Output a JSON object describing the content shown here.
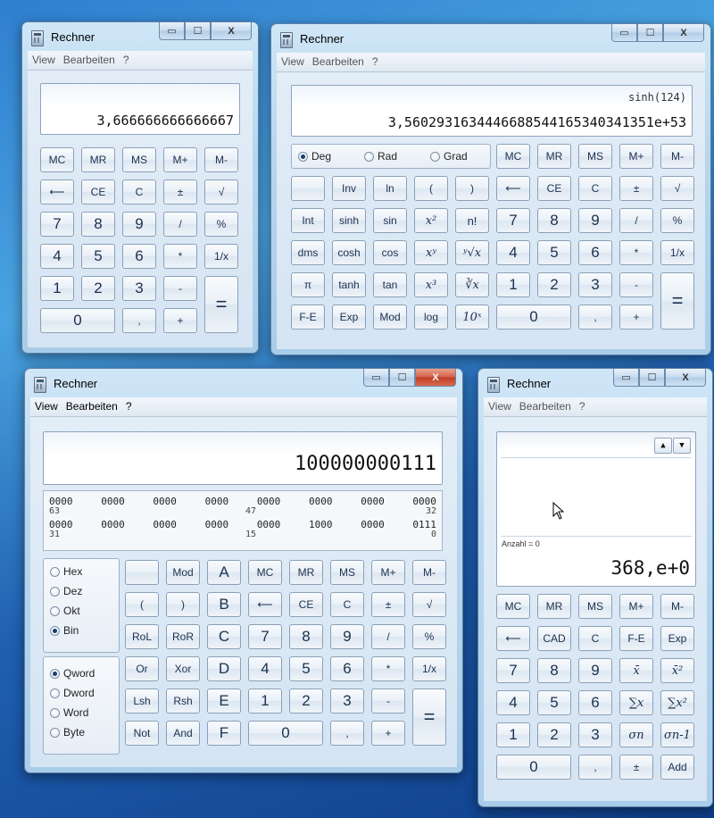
{
  "title": "Rechner",
  "menu": [
    "View",
    "Bearbeiten",
    "?"
  ],
  "window_controls": {
    "minimize": "▭",
    "maximize": "☐",
    "close": "X"
  },
  "std": {
    "display": "3,666666666666667",
    "rows": [
      [
        "MC",
        "MR",
        "MS",
        "M+",
        "M-"
      ],
      [
        "⟵",
        "CE",
        "C",
        "±",
        "√"
      ],
      [
        "7",
        "8",
        "9",
        "/",
        "%"
      ],
      [
        "4",
        "5",
        "6",
        "*",
        "1/x"
      ],
      [
        "1",
        "2",
        "3",
        "-"
      ],
      [
        "0",
        ",",
        "+"
      ]
    ],
    "equals": "="
  },
  "sci": {
    "expression": "sinh(124)",
    "display": "3,5602931634446688544165340341351e+53",
    "angle_modes": [
      "Deg",
      "Rad",
      "Grad"
    ],
    "selected_angle": "Deg",
    "fn_rows": [
      [
        "",
        "Inv",
        "ln",
        "(",
        ")"
      ],
      [
        "Int",
        "sinh",
        "sin",
        "x²",
        "n!"
      ],
      [
        "dms",
        "cosh",
        "cos",
        "xʸ",
        "ʸ√x"
      ],
      [
        "π",
        "tanh",
        "tan",
        "x³",
        "∛x"
      ],
      [
        "F-E",
        "Exp",
        "Mod",
        "log",
        "10ˣ"
      ]
    ],
    "num_rows": [
      [
        "MC",
        "MR",
        "MS",
        "M+",
        "M-"
      ],
      [
        "⟵",
        "CE",
        "C",
        "±",
        "√"
      ],
      [
        "7",
        "8",
        "9",
        "/",
        "%"
      ],
      [
        "4",
        "5",
        "6",
        "*",
        "1/x"
      ],
      [
        "1",
        "2",
        "3",
        "-"
      ],
      [
        "0",
        ",",
        "+"
      ]
    ],
    "equals": "="
  },
  "prog": {
    "display": "100000000111",
    "bits_row1": [
      "0000",
      "0000",
      "0000",
      "0000",
      "0000",
      "0000",
      "0000",
      "0000"
    ],
    "bits_row1_idx": [
      "63",
      "47",
      "32"
    ],
    "bits_row2": [
      "0000",
      "0000",
      "0000",
      "0000",
      "0000",
      "1000",
      "0000",
      "0111"
    ],
    "bits_row2_idx": [
      "31",
      "15",
      "0"
    ],
    "base_modes": [
      "Hex",
      "Dez",
      "Okt",
      "Bin"
    ],
    "selected_base": "Bin",
    "word_modes": [
      "Qword",
      "Dword",
      "Word",
      "Byte"
    ],
    "selected_word": "Qword",
    "rows": [
      [
        "",
        "Mod",
        "A",
        "MC",
        "MR",
        "MS",
        "M+",
        "M-"
      ],
      [
        "(",
        ")",
        "B",
        "⟵",
        "CE",
        "C",
        "±",
        "√"
      ],
      [
        "RoL",
        "RoR",
        "C",
        "7",
        "8",
        "9",
        "/",
        "%"
      ],
      [
        "Or",
        "Xor",
        "D",
        "4",
        "5",
        "6",
        "*",
        "1/x"
      ],
      [
        "Lsh",
        "Rsh",
        "E",
        "1",
        "2",
        "3",
        "-"
      ],
      [
        "Not",
        "And",
        "F",
        "0",
        ",",
        "+"
      ]
    ],
    "equals": "="
  },
  "stat": {
    "count_label": "Anzahl = 0",
    "display": "368,e+0",
    "rows": [
      [
        "MC",
        "MR",
        "MS",
        "M+",
        "M-"
      ],
      [
        "⟵",
        "CAD",
        "C",
        "F-E",
        "Exp"
      ],
      [
        "7",
        "8",
        "9",
        "x̄",
        "x̄²"
      ],
      [
        "4",
        "5",
        "6",
        "∑x",
        "∑x²"
      ],
      [
        "1",
        "2",
        "3",
        "σn",
        "σn-1"
      ],
      [
        "0",
        ",",
        "±",
        "Add"
      ]
    ]
  }
}
